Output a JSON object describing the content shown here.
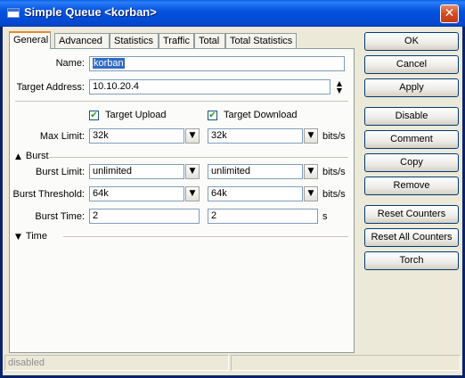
{
  "window": {
    "title": "Simple Queue <korban>",
    "close_glyph": "✕"
  },
  "tabs": [
    {
      "label": "General",
      "active": true
    },
    {
      "label": "Advanced"
    },
    {
      "label": "Statistics"
    },
    {
      "label": "Traffic"
    },
    {
      "label": "Total"
    },
    {
      "label": "Total Statistics"
    }
  ],
  "general": {
    "name_label": "Name:",
    "name_value": "korban",
    "target_label": "Target Address:",
    "target_value": "10.10.20.4",
    "target_upload_label": "Target Upload",
    "target_upload_checked": true,
    "target_download_label": "Target Download",
    "target_download_checked": true,
    "max_limit_label": "Max Limit:",
    "max_limit_upload": "32k",
    "max_limit_download": "32k",
    "unit_bits": "bits/s",
    "burst_section": "Burst",
    "burst_limit_label": "Burst Limit:",
    "burst_limit_upload": "unlimited",
    "burst_limit_download": "unlimited",
    "burst_threshold_label": "Burst Threshold:",
    "burst_threshold_upload": "64k",
    "burst_threshold_download": "64k",
    "burst_time_label": "Burst Time:",
    "burst_time_upload": "2",
    "burst_time_download": "2",
    "unit_seconds": "s",
    "time_section": "Time"
  },
  "buttons": {
    "ok": "OK",
    "cancel": "Cancel",
    "apply": "Apply",
    "disable": "Disable",
    "comment": "Comment",
    "copy": "Copy",
    "remove": "Remove",
    "reset_counters": "Reset Counters",
    "reset_all_counters": "Reset All Counters",
    "torch": "Torch"
  },
  "status_bar": {
    "state": "disabled"
  },
  "icons": {
    "dropdown": "down-arrow-icon",
    "expand": "triangle-icon",
    "spinner": "up-down-spinner-icon"
  },
  "colors": {
    "title_bar": "#0553de",
    "active_tab_accent": "#e68b2c",
    "selection": "#316ac5",
    "close_button": "#d7491f"
  }
}
